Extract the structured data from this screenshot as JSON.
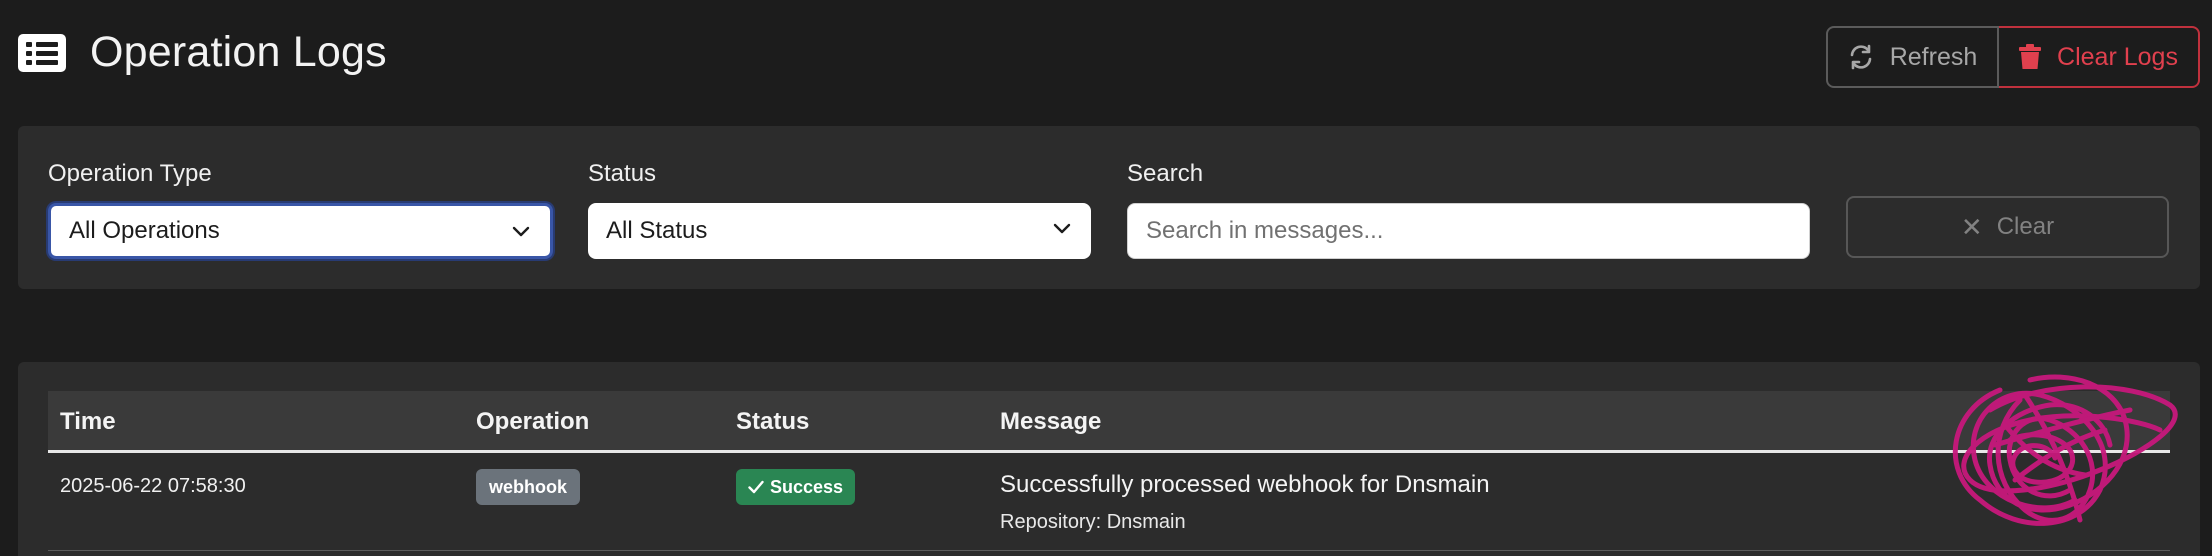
{
  "header": {
    "title": "Operation Logs",
    "title_icon": "list-icon",
    "refresh_label": "Refresh",
    "refresh_icon": "sync-icon",
    "clear_logs_label": "Clear Logs",
    "clear_logs_icon": "trash-icon"
  },
  "filters": {
    "operation_type": {
      "label": "Operation Type",
      "selected": "All Operations"
    },
    "status": {
      "label": "Status",
      "selected": "All Status"
    },
    "search": {
      "label": "Search",
      "placeholder": "Search in messages...",
      "value": ""
    },
    "clear_label": "Clear",
    "clear_icon": "close-icon"
  },
  "table": {
    "columns": [
      "Time",
      "Operation",
      "Status",
      "Message"
    ],
    "rows": [
      {
        "time": "2025-06-22 07:58:30",
        "operation": "webhook",
        "status": "Success",
        "message": "Successfully processed webhook for Dnsmain",
        "detail": "Repository: Dnsmain"
      }
    ]
  },
  "colors": {
    "background": "#1c1c1c",
    "panel": "#2c2c2c",
    "danger": "#e1404e",
    "success_badge": "#2a8653",
    "secondary_badge": "#6b737b",
    "scribble": "#c7187c"
  }
}
